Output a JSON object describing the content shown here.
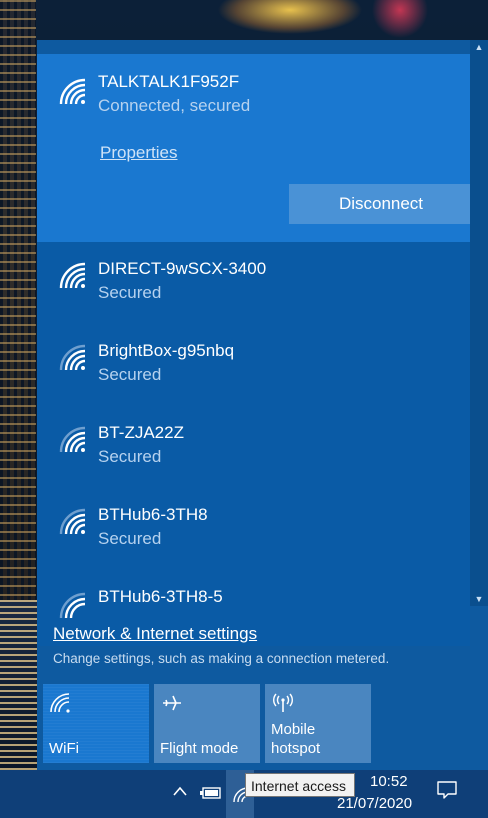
{
  "networks": [
    {
      "name": "TALKTALK1F952F",
      "status": "Connected, secured"
    },
    {
      "name": "DIRECT-9wSCX-3400",
      "status": "Secured"
    },
    {
      "name": "BrightBox-g95nbq",
      "status": "Secured"
    },
    {
      "name": "BT-ZJA22Z",
      "status": "Secured"
    },
    {
      "name": "BTHub6-3TH8",
      "status": "Secured"
    },
    {
      "name": "BTHub6-3TH8-5",
      "status": ""
    }
  ],
  "connected": {
    "properties_label": "Properties",
    "disconnect_label": "Disconnect"
  },
  "settings": {
    "link_label": "Network & Internet settings",
    "description": "Change settings, such as making a connection metered."
  },
  "quick_actions": [
    {
      "label": "WiFi",
      "icon": "wifi-icon",
      "active": true
    },
    {
      "label": "Flight mode",
      "icon": "airplane-icon",
      "active": false
    },
    {
      "label": "Mobile\nhotspot",
      "icon": "hotspot-icon",
      "active": false
    }
  ],
  "taskbar": {
    "time": "10:52",
    "date": "21/07/2020",
    "tooltip": "Internet access",
    "overflow_icon": "chevron-up-icon",
    "battery_icon": "battery-icon",
    "notification_icon": "notification-icon"
  },
  "colors": {
    "panel": "#0e5aa0",
    "connected_bg": "#1a78d0",
    "tile_active": "#1a78d0",
    "tile_inactive": "#4a86c0",
    "taskbar": "#0f3f78"
  }
}
